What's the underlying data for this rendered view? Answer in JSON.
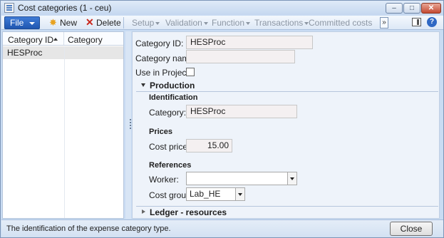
{
  "window": {
    "title": "Cost categories (1 - ceu)",
    "min_glyph": "–",
    "max_glyph": "□",
    "close_glyph": "✕"
  },
  "toolbar": {
    "file_label": "File",
    "new_label": "New",
    "delete_label": "Delete",
    "setup_label": "Setup",
    "validation_label": "Validation",
    "function_label": "Function",
    "transactions_label": "Transactions",
    "committed_costs_label": "Committed costs",
    "overflow_glyph": "»",
    "help_glyph": "?"
  },
  "grid": {
    "columns": [
      "Category ID",
      "Category name"
    ],
    "rows": [
      {
        "category_id": "HESProc",
        "category_name": ""
      }
    ]
  },
  "form": {
    "category_id_label": "Category ID:",
    "category_id_value": "HESProc",
    "category_name_label": "Category name:",
    "category_name_value": "",
    "use_in_project_label": "Use in Project:",
    "use_in_project_checked": false,
    "production": {
      "title": "Production",
      "identification_label": "Identification",
      "category_label": "Category:",
      "category_value": "HESProc",
      "prices_label": "Prices",
      "cost_price_label": "Cost price:",
      "cost_price_value": "15.00",
      "references_label": "References",
      "worker_label": "Worker:",
      "worker_value": "",
      "cost_group_label": "Cost group:",
      "cost_group_value": "Lab_HE"
    },
    "ledger_title": "Ledger - resources"
  },
  "statusbar": {
    "text": "The identification of the expense category type.",
    "close_label": "Close"
  },
  "colors": {
    "accent": "#1f56b0",
    "window_bg": "#c9dcf3",
    "form_bg": "#eef3fa"
  }
}
